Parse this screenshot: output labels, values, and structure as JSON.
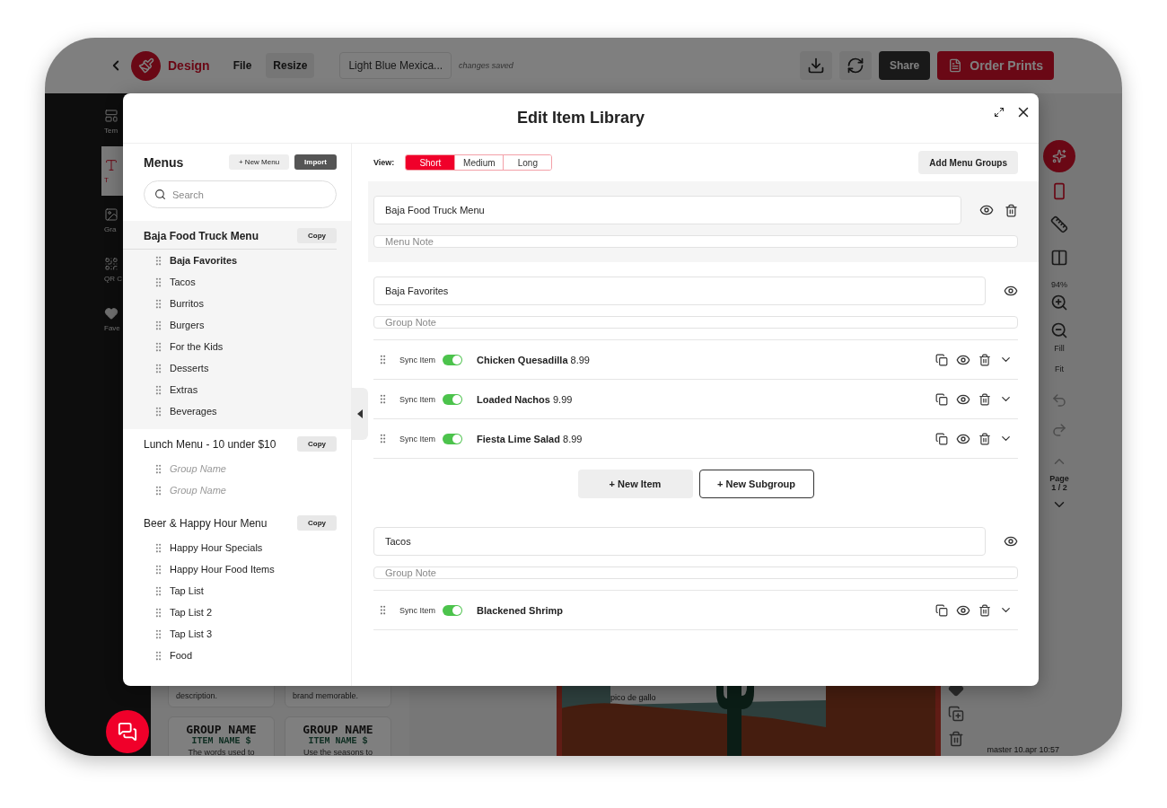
{
  "app": {
    "brand": "Design",
    "menu": [
      {
        "label": "File",
        "kind": "text"
      },
      {
        "label": "Resize",
        "kind": "button"
      }
    ],
    "document_title": "Light Blue Mexica...",
    "save_status": "changes saved",
    "share": "Share",
    "order": "Order Prints"
  },
  "left_rail": [
    {
      "label": "Tem",
      "selected": false,
      "kind": "template"
    },
    {
      "label": "T",
      "selected": true,
      "kind": "text"
    },
    {
      "label": "Gra",
      "selected": false,
      "kind": "graphic"
    },
    {
      "label": "QR C",
      "selected": false,
      "kind": "qr"
    },
    {
      "label": "Fave",
      "selected": false,
      "kind": "favorite"
    }
  ],
  "template_cards": [
    {
      "text": "description."
    },
    {
      "text": "brand memorable."
    },
    {
      "title": "GROUP NAME",
      "item": "ITEM NAME $",
      "text": "The words used to"
    },
    {
      "title": "GROUP NAME",
      "item": "ITEM NAME $",
      "text": "Use the seasons to"
    }
  ],
  "canvas": {
    "caption": "pico de gallo"
  },
  "right_rail": {
    "zoom": "94%",
    "fill": "Fill",
    "fit": "Fit",
    "page_label": "Page",
    "page_count": "1 / 2"
  },
  "version": "master 10.apr 10:57",
  "modal": {
    "title": "Edit Item Library",
    "sidebar": {
      "title": "Menus",
      "new_button": "+ New Menu",
      "import_button": "Import",
      "search_placeholder": "Search",
      "menus": [
        {
          "name": "Baja Food Truck Menu",
          "copy": "Copy",
          "selected": true,
          "groups": [
            {
              "label": "Baja Favorites",
              "kind": "group",
              "selected": true
            },
            {
              "label": "Tacos",
              "kind": "group",
              "selected": false
            },
            {
              "label": "Burritos",
              "kind": "group",
              "selected": false
            },
            {
              "label": "Burgers",
              "kind": "group",
              "selected": false
            },
            {
              "label": "For the Kids",
              "kind": "group",
              "selected": false
            },
            {
              "label": "Desserts",
              "kind": "group",
              "selected": false
            },
            {
              "label": "Extras",
              "kind": "group",
              "selected": false
            },
            {
              "label": "Beverages",
              "kind": "group",
              "selected": false
            }
          ]
        },
        {
          "name": "Lunch Menu - 10 under $10",
          "copy": "Copy",
          "selected": false,
          "groups": [
            {
              "label": "Group Name",
              "kind": "placeholder",
              "selected": false
            },
            {
              "label": "Group Name",
              "kind": "placeholder",
              "selected": false
            }
          ]
        },
        {
          "name": "Beer & Happy Hour Menu",
          "copy": "Copy",
          "selected": false,
          "groups": [
            {
              "label": "Happy Hour Specials",
              "kind": "group",
              "selected": false
            },
            {
              "label": "Happy Hour Food Items",
              "kind": "group",
              "selected": false
            },
            {
              "label": "Tap List",
              "kind": "group",
              "selected": false
            },
            {
              "label": "Tap List 2",
              "kind": "group",
              "selected": false
            },
            {
              "label": "Tap List 3",
              "kind": "group",
              "selected": false
            },
            {
              "label": "Food",
              "kind": "group",
              "selected": false
            }
          ]
        }
      ]
    },
    "editor": {
      "view_label": "View:",
      "views": [
        {
          "label": "Short",
          "selected": true
        },
        {
          "label": "Medium",
          "selected": false
        },
        {
          "label": "Long",
          "selected": false
        }
      ],
      "add_groups_button": "Add Menu Groups",
      "menu_name": "Baja Food Truck Menu",
      "menu_note_placeholder": "Menu Note",
      "groups": [
        {
          "name": "Baja Favorites",
          "note_placeholder": "Group Note",
          "items": [
            {
              "sync_label": "Sync Item",
              "sync": true,
              "name": "Chicken Quesadilla",
              "price": "8.99"
            },
            {
              "sync_label": "Sync Item",
              "sync": true,
              "name": "Loaded Nachos",
              "price": "9.99"
            },
            {
              "sync_label": "Sync Item",
              "sync": true,
              "name": "Fiesta Lime Salad",
              "price": "8.99"
            }
          ],
          "new_item_button": "+ New Item",
          "new_subgroup_button": "+ New Subgroup"
        },
        {
          "name": "Tacos",
          "note_placeholder": "Group Note",
          "items": [
            {
              "sync_label": "Sync Item",
              "sync": true,
              "name": "Blackened Shrimp"
            }
          ]
        }
      ]
    }
  }
}
